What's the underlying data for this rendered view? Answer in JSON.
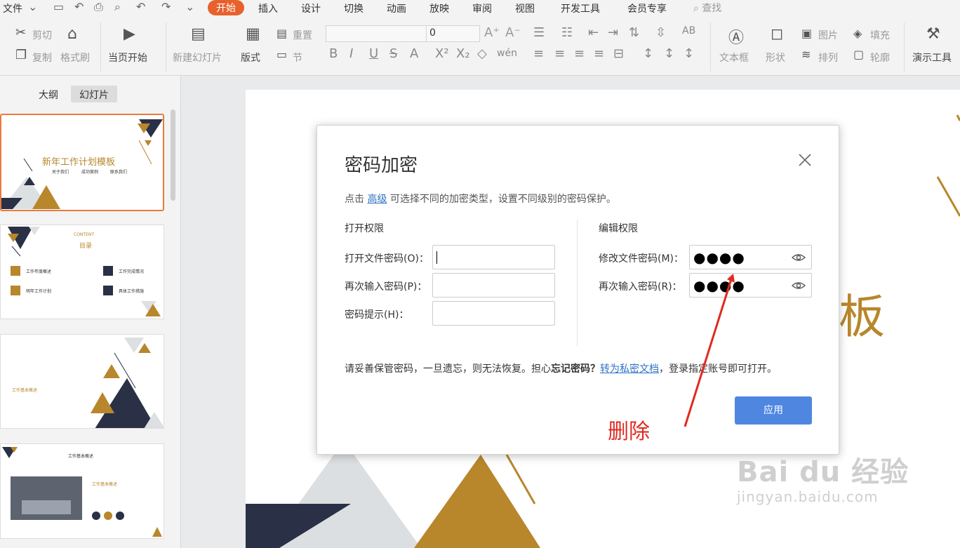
{
  "menubar": {
    "file": "文件",
    "tabs": [
      "开始",
      "插入",
      "设计",
      "切换",
      "动画",
      "放映",
      "审阅",
      "视图",
      "开发工具",
      "会员专享"
    ],
    "search": "查找"
  },
  "ribbon": {
    "cut": "剪切",
    "copy": "复制",
    "format_painter": "格式刷",
    "play_from_current": "当页开始",
    "new_slide": "新建幻灯片",
    "layout": "版式",
    "reset": "重置",
    "section": "节",
    "font_size": "0",
    "textbox": "文本框",
    "shape": "形状",
    "picture": "图片",
    "fill": "填充",
    "arrange": "排列",
    "outline": "轮廓",
    "presentation_tools": "演示工具"
  },
  "leftpanel": {
    "tabs": [
      "大纲",
      "幻灯片"
    ],
    "slides": [
      {
        "title": "新年工作计划模板",
        "small": [
          "关于我们",
          "成功案例",
          "联系我们"
        ]
      },
      {
        "title": "目录",
        "small": [
          "CONTENT",
          "工作年度概述",
          "工作完成情况",
          "明年工作计划",
          "具体工作措施"
        ]
      },
      {
        "title": "工作基本概述"
      },
      {
        "title": "工作基本概述",
        "small": [
          "工作基本概述"
        ]
      }
    ]
  },
  "canvas": {
    "partial_title_char": "板"
  },
  "dialog": {
    "title": "密码加密",
    "desc_before": "点击",
    "desc_link": "高级",
    "desc_after": "可选择不同的加密类型，设置不同级别的密码保护。",
    "open_section": "打开权限",
    "edit_section": "编辑权限",
    "open_password_label": "打开文件密码(O)：",
    "open_confirm_label": "再次输入密码(P)：",
    "hint_label": "密码提示(H)：",
    "edit_password_label": "修改文件密码(M)：",
    "edit_confirm_label": "再次输入密码(R)：",
    "edit_password_value": "●●●●",
    "edit_confirm_value": "●●●●",
    "warn_before": "请妥善保管密码，一旦遗忘，则无法恢复。担心",
    "warn_bold": "忘记密码？",
    "warn_link": "转为私密文档",
    "warn_after": "，登录指定账号即可打开。",
    "apply": "应用"
  },
  "annotation": {
    "text": "删除",
    "color": "#e02a20"
  },
  "watermark": {
    "main": "Bai du 经验",
    "sub": "jingyan.baidu.com"
  },
  "colors": {
    "accent": "#e8612c",
    "gold": "#b8862b",
    "navy": "#2a3045",
    "button": "#4f87e0",
    "link": "#2f73c3"
  }
}
